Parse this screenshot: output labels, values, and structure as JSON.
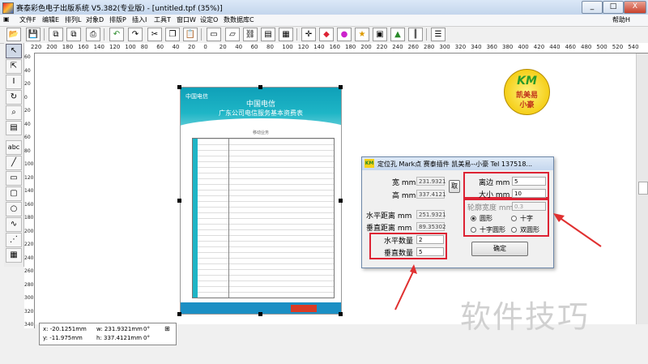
{
  "window": {
    "title": "赛泰彩色电子出版系统 V5.382(专业版) - [untitled.tpf (35%)]",
    "controls": [
      "_",
      "□",
      "X"
    ]
  },
  "menu": {
    "items": [
      "文件F",
      "编辑E",
      "排列L",
      "对象D",
      "排版P",
      "插入I",
      "工具T",
      "窗口W",
      "设定O",
      "数数据库C"
    ],
    "help": "帮助H"
  },
  "ruler": {
    "h_ticks": [
      "220",
      "200",
      "180",
      "160",
      "140",
      "120",
      "100",
      "80",
      "60",
      "40",
      "20",
      "0",
      "20",
      "40",
      "60",
      "80",
      "100",
      "120",
      "140",
      "160",
      "180",
      "200",
      "220",
      "240",
      "260",
      "280",
      "300",
      "320",
      "340",
      "360",
      "380",
      "400",
      "420",
      "440",
      "460",
      "480",
      "500",
      "520",
      "540"
    ],
    "v_ticks": [
      "60",
      "40",
      "20",
      "0",
      "20",
      "40",
      "60",
      "80",
      "100",
      "120",
      "140",
      "160",
      "180",
      "200",
      "220",
      "240",
      "260",
      "280",
      "300",
      "320",
      "340"
    ]
  },
  "poster": {
    "logo": "中国电信",
    "title1": "中国电信",
    "title2": "广东公司电信服务基本资费表",
    "subtitle": "移动业务"
  },
  "stamp": {
    "logo_text": "KM",
    "line1": "凯美易",
    "line2": "小豪"
  },
  "dialog": {
    "title": "定位孔  Mark点 赛泰插件 凯美易--小豪 Tel 137518...",
    "width_label": "宽 mm",
    "width_value": "231.9321",
    "height_label": "高 mm",
    "height_value": "337.4121",
    "fetch_button": "取",
    "margin_label": "离边 mm",
    "margin_value": "5",
    "size_label": "大小 mm",
    "size_value": "10",
    "outline_label": "轮廓宽度 mm",
    "outline_value": "0.3",
    "hdist_label": "水平距离 mm",
    "hdist_value": "251.9321",
    "vdist_label": "垂直距离 mm",
    "vdist_value": "89.35302",
    "hcount_label": "水平数量",
    "hcount_value": "2",
    "vcount_label": "垂直数量",
    "vcount_value": "5",
    "shape_circle": "圆形",
    "shape_cross": "十字",
    "shape_crosscircle": "十字圆形",
    "shape_doublecircle": "双圆形",
    "selected_shape": "圆形",
    "ok_button": "确定"
  },
  "status": {
    "x": "x: -20.1251mm",
    "w": "w: 231.9321mm",
    "angle1": "0°",
    "y": "y: -11.975mm",
    "h": "h: 337.4121mm",
    "angle2": "0°"
  },
  "watermark": "软件技巧",
  "colors": {
    "accent_red": "#dd2233",
    "poster_teal": "#1eb5c6",
    "titlebar": "#c3d5ec"
  }
}
